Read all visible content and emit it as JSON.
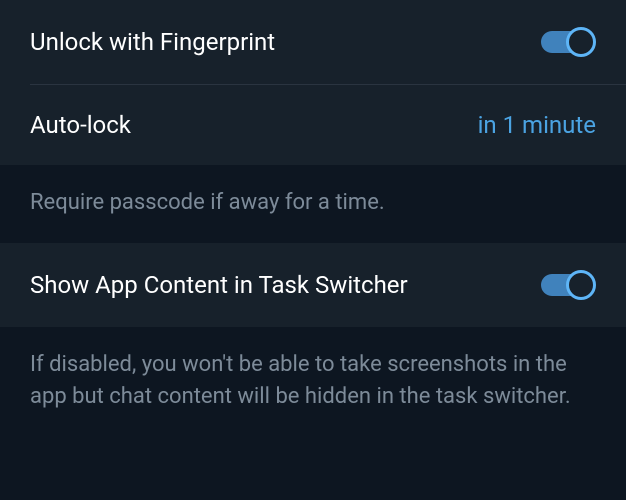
{
  "settings": {
    "fingerprint": {
      "label": "Unlock with Fingerprint",
      "enabled": true
    },
    "autolock": {
      "label": "Auto-lock",
      "value": "in 1 minute",
      "description": "Require passcode if away for a time."
    },
    "taskSwitcher": {
      "label": "Show App Content in Task Switcher",
      "enabled": true,
      "description": "If disabled, you won't be able to take screenshots in the app but chat content will be hidden in the task switcher."
    }
  }
}
